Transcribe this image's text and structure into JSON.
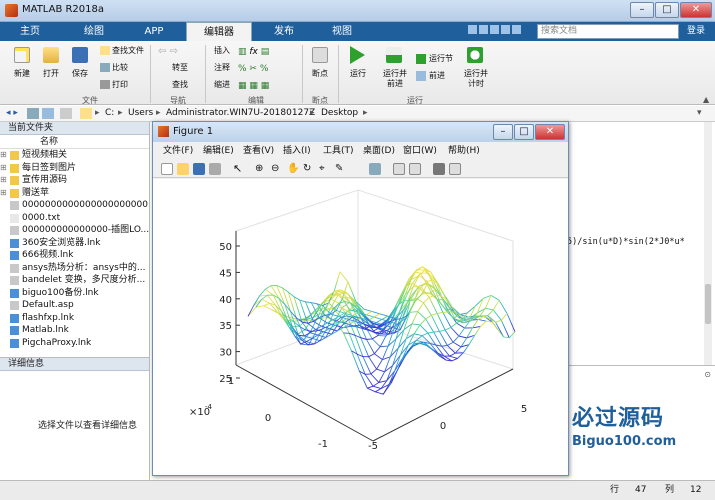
{
  "app": {
    "title": "MATLAB R2018a"
  },
  "window_controls": {
    "minimize": "–",
    "maximize": "□",
    "close": "✕"
  },
  "tabs": [
    {
      "label": "主页"
    },
    {
      "label": "绘图"
    },
    {
      "label": "APP"
    },
    {
      "label": "编辑器"
    },
    {
      "label": "发布"
    },
    {
      "label": "视图"
    }
  ],
  "search": {
    "placeholder": "搜索文档"
  },
  "login": "登录",
  "ribbon": {
    "new": "新建",
    "open": "打开",
    "save": "保存",
    "find_files": "查找文件",
    "compare": "比较",
    "print": "打印",
    "goto": "转至",
    "find": "查找",
    "insert": "插入",
    "comment": "注释",
    "indent": "缩进",
    "breakpoints": "断点",
    "run": "运行",
    "run_advance": "运行并\n前进",
    "run_section": "运行节",
    "advance": "前进",
    "run_time": "运行并\n计时",
    "group_file": "文件",
    "group_nav": "导航",
    "group_edit": "编辑",
    "group_bp": "断点",
    "group_run": "运行"
  },
  "address": {
    "parts": [
      "C:",
      "Users",
      "Administrator.WIN7U-20180127Z",
      "Desktop"
    ]
  },
  "current_folder": {
    "title": "当前文件夹",
    "col_name": "名称",
    "items": [
      {
        "name": "短视频相关",
        "type": "folder"
      },
      {
        "name": "每日签到图片",
        "type": "folder"
      },
      {
        "name": "宣传用源码",
        "type": "folder"
      },
      {
        "name": "赠送苹",
        "type": "folder"
      },
      {
        "name": "0000000000000000000000...",
        "type": "file"
      },
      {
        "name": "0000.txt",
        "type": "txt"
      },
      {
        "name": "000000000000000-插图LO...",
        "type": "file"
      },
      {
        "name": "360安全浏览器.lnk",
        "type": "lnk"
      },
      {
        "name": "666视频.lnk",
        "type": "lnk"
      },
      {
        "name": "ansys热场分析：ansys中的...",
        "type": "file"
      },
      {
        "name": "bandelet 变换，多尺度分析...",
        "type": "file"
      },
      {
        "name": "biguo100备份.lnk",
        "type": "lnk"
      },
      {
        "name": "Default.asp",
        "type": "file"
      },
      {
        "name": "flashfxp.lnk",
        "type": "lnk"
      },
      {
        "name": "Matlab.lnk",
        "type": "lnk"
      },
      {
        "name": "PigchaProxy.lnk",
        "type": "lnk"
      }
    ]
  },
  "details": {
    "title": "详细信息",
    "empty_msg": "选择文件以查看详细信息"
  },
  "command_window": {
    "code_fragment": "5)/sin(u*D)*sin(2*J0*u*"
  },
  "status": {
    "row_label": "行",
    "row": "47",
    "col_label": "列",
    "col": "12"
  },
  "watermark": {
    "brand": "必过源码",
    "site": "Biguo100.com"
  },
  "figure": {
    "title": "Figure 1",
    "menu": [
      "文件(F)",
      "编辑(E)",
      "查看(V)",
      "插入(I)",
      "工具(T)",
      "桌面(D)",
      "窗口(W)",
      "帮助(H)"
    ],
    "zlabels": [
      "50",
      "45",
      "40",
      "35",
      "30",
      "25"
    ],
    "y_ticks": [
      "1",
      "0",
      "-1"
    ],
    "x_ticks": [
      "5",
      "0",
      "-5"
    ],
    "exponent": "×10",
    "exponent_power": "-4"
  },
  "colors": {
    "accent": "#1f5f9c",
    "ribbon_bg": "#f3f3f3"
  }
}
